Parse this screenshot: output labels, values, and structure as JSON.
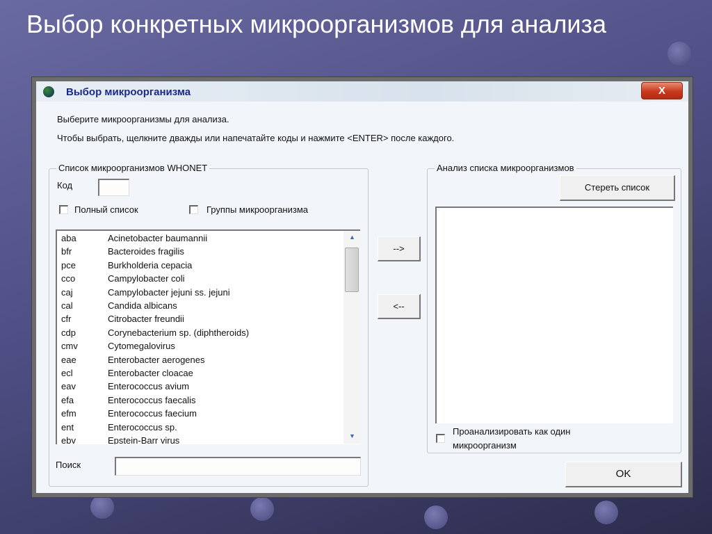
{
  "slide": {
    "title": "Выбор конкретных микроорганизмов для анализа"
  },
  "window": {
    "title": "Выбор микроорганизма",
    "close_label": "X"
  },
  "instructions": [
    "Выберите микроорганизмы для анализа.",
    "Чтобы выбрать, щелкните дважды или напечатайте коды и нажмите <ENTER> после каждого."
  ],
  "left_group": {
    "legend": "Список микроорганизмов WHONET",
    "code_label": "Код",
    "code_value": "",
    "full_list_label": "Полный список",
    "full_list_checked": false,
    "groups_label": "Группы микроорганизма",
    "groups_checked": false,
    "organisms": [
      {
        "code": "aba",
        "name": "Acinetobacter baumannii"
      },
      {
        "code": "bfr",
        "name": "Bacteroides fragilis"
      },
      {
        "code": "pce",
        "name": "Burkholderia cepacia"
      },
      {
        "code": "cco",
        "name": "Campylobacter coli"
      },
      {
        "code": "caj",
        "name": "Campylobacter jejuni ss. jejuni"
      },
      {
        "code": "cal",
        "name": "Candida albicans"
      },
      {
        "code": "cfr",
        "name": "Citrobacter freundii"
      },
      {
        "code": "cdp",
        "name": "Corynebacterium sp. (diphtheroids)"
      },
      {
        "code": "cmv",
        "name": "Cytomegalovirus"
      },
      {
        "code": "eae",
        "name": "Enterobacter aerogenes"
      },
      {
        "code": "ecl",
        "name": "Enterobacter cloacae"
      },
      {
        "code": "eav",
        "name": "Enterococcus avium"
      },
      {
        "code": "efa",
        "name": "Enterococcus faecalis"
      },
      {
        "code": "efm",
        "name": "Enterococcus faecium"
      },
      {
        "code": "ent",
        "name": "Enterococcus sp."
      },
      {
        "code": "ebv",
        "name": "Epstein-Barr virus"
      }
    ],
    "search_label": "Поиск",
    "search_value": ""
  },
  "buttons": {
    "add": "-->",
    "remove": "<--",
    "clear": "Стереть список",
    "ok": "OK"
  },
  "right_group": {
    "legend": "Анализ списка микроорганизмов",
    "single_label_1": "Проанализировать как один",
    "single_label_2": "микроорганизм",
    "single_checked": false
  }
}
